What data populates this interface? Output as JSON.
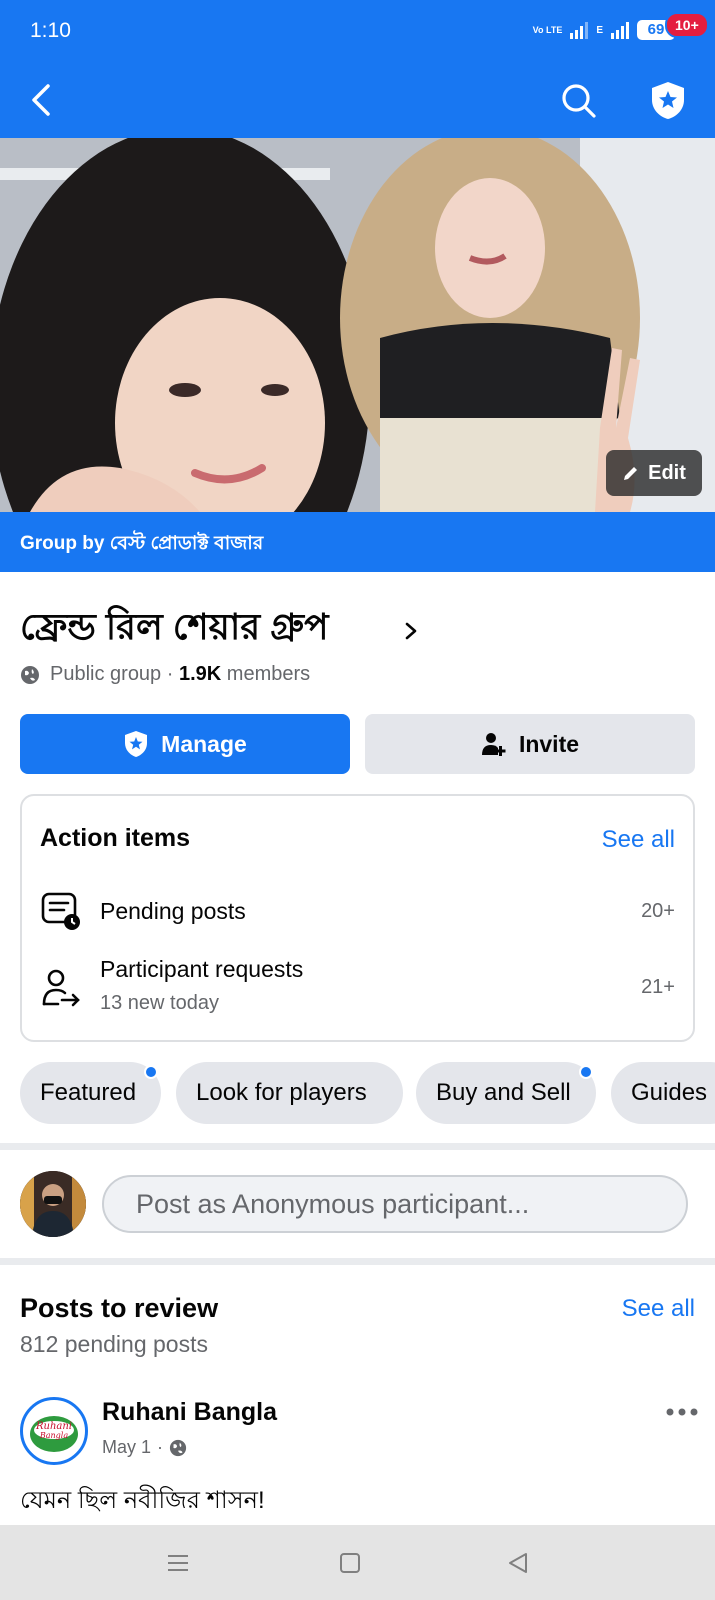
{
  "status_bar": {
    "time": "1:10",
    "network_label": "Vo LTE",
    "network_type": "E",
    "battery": "69"
  },
  "app_bar": {
    "notification_badge": "10+",
    "icons": [
      "back-arrow-icon",
      "search-icon",
      "shield-star-icon"
    ]
  },
  "cover": {
    "edit_label": "Edit"
  },
  "group": {
    "owner_line": "Group by বেস্ট প্রোডাক্ট বাজার",
    "name": "ফ্রেন্ড রিল শেয়ার গ্রুপ",
    "privacy": "Public group",
    "separator": "·",
    "member_count": "1.9K",
    "members_label": "members"
  },
  "actions": {
    "manage_label": "Manage",
    "invite_label": "Invite"
  },
  "action_items": {
    "title": "Action items",
    "see_all": "See all",
    "rows": [
      {
        "label": "Pending posts",
        "sub": "",
        "count": "20+"
      },
      {
        "label": "Participant requests",
        "sub": "13 new today",
        "count": "21+"
      }
    ]
  },
  "chips": [
    {
      "label": "Featured",
      "dot": true
    },
    {
      "label": "Look for players",
      "dot": false
    },
    {
      "label": "Buy and Sell",
      "dot": true
    },
    {
      "label": "Guides",
      "dot": false
    }
  ],
  "composer": {
    "placeholder": "Post as Anonymous participant..."
  },
  "posts_to_review": {
    "title": "Posts to review",
    "see_all": "See all",
    "subtitle": "812 pending posts"
  },
  "post": {
    "author": "Ruhani Bangla",
    "date": "May 1",
    "separator": "·",
    "text": "যেমন ছিল নবীজির শাসন!",
    "avatar_text": "Ruhani Bangla"
  },
  "colors": {
    "brand_blue": "#1877f2",
    "badge_red": "#e41e3f",
    "chip_gray": "#e4e6eb",
    "secondary_text": "#65676b"
  }
}
